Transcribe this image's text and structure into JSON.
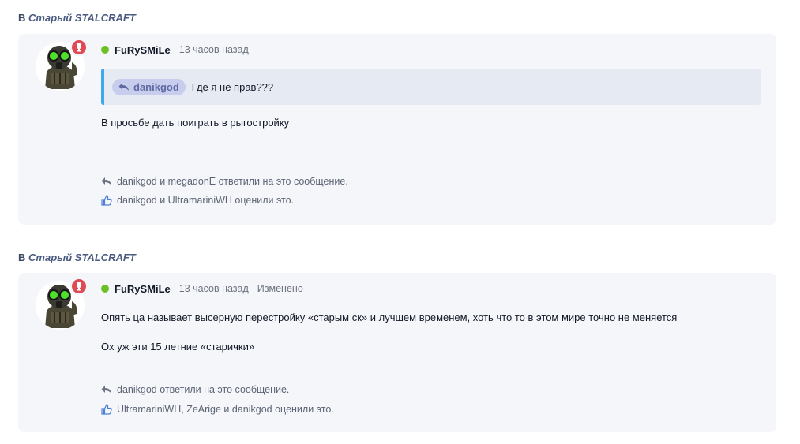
{
  "posts": [
    {
      "header": {
        "prefix": "В",
        "forum": "Старый STALCRAFT"
      },
      "author": "FuRySMiLe",
      "time": "13 часов назад",
      "edited": "",
      "quote": {
        "author": "danikgod",
        "text": "Где я не прав???"
      },
      "body": [
        "В просьбе дать поиграть в рыгостройку"
      ],
      "replies": "danikgod и megadonE ответили на это сообщение.",
      "likes": "danikgod и UltramariniWH оценили это."
    },
    {
      "header": {
        "prefix": "В",
        "forum": "Старый STALCRAFT"
      },
      "author": "FuRySMiLe",
      "time": "13 часов назад",
      "edited": "Изменено",
      "body": [
        "Опять ца называет высерную перестройку «старым ск» и лучшем временем, хоть что то в этом мире точно не меняется",
        "Ох уж эти 15 летние «старички»"
      ],
      "replies": "danikgod ответили на это сообщение.",
      "likes": "UltramariniWH, ZeArige и danikgod оценили это."
    }
  ],
  "colors": {
    "online": "#6cc024",
    "badge": "#df4b55",
    "quote_border": "#3ea8f0",
    "card_bg": "#f5f6fa"
  }
}
